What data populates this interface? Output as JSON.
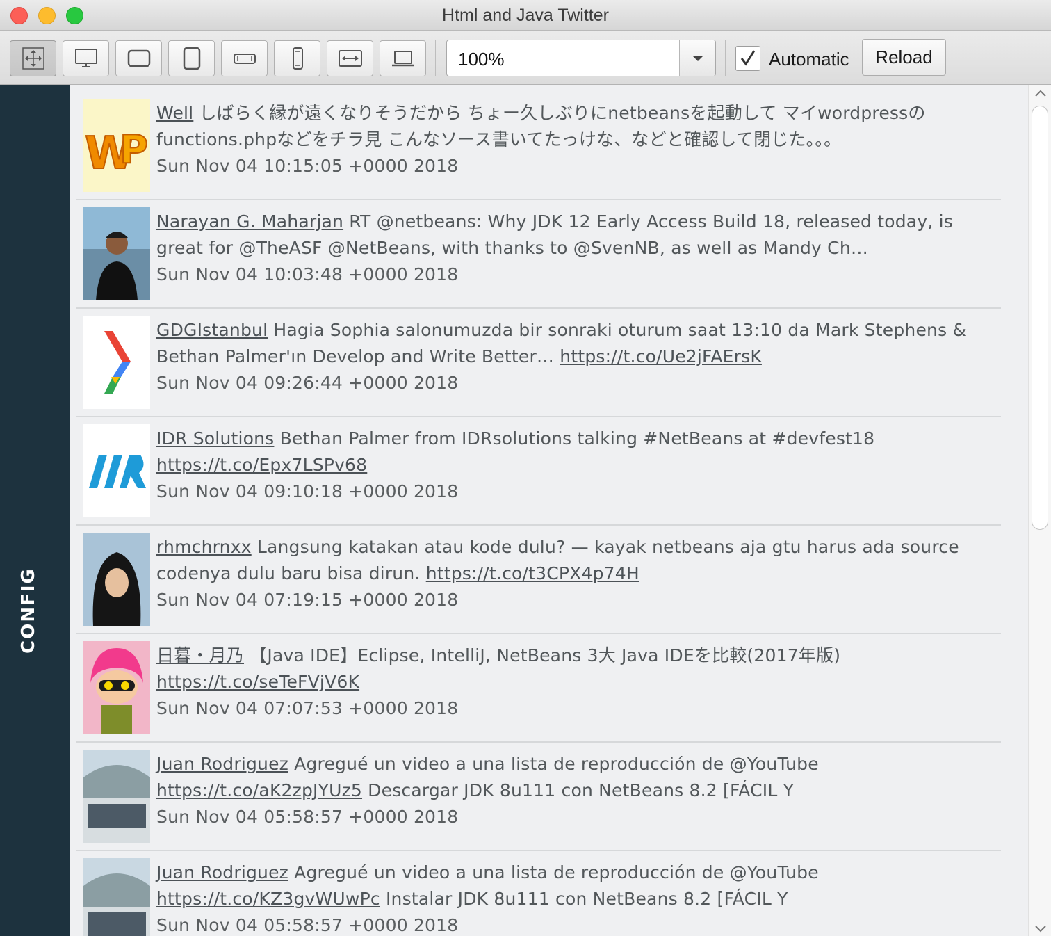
{
  "window": {
    "title": "Html and Java Twitter"
  },
  "toolbar": {
    "device_buttons": [
      {
        "icon": "move-arrows-icon"
      },
      {
        "icon": "desktop-icon"
      },
      {
        "icon": "tablet-landscape-icon"
      },
      {
        "icon": "tablet-portrait-icon"
      },
      {
        "icon": "phone-landscape-icon"
      },
      {
        "icon": "phone-portrait-icon"
      },
      {
        "icon": "fit-width-icon"
      },
      {
        "icon": "laptop-icon"
      }
    ],
    "zoom_value": "100%",
    "automatic_label": "Automatic",
    "automatic_checked": true,
    "reload_label": "Reload"
  },
  "sidebar": {
    "label": "CONFIG"
  },
  "tweets": [
    {
      "user": "Well",
      "text": "しばらく縁が遠くなりそうだから ちょー久しぶりにnetbeansを起動して マイwordpressのfunctions.phpなどをチラ見 こんなソース書いてたっけな、などと確認して閉じた。。。",
      "link": "",
      "text_after": "",
      "date": "Sun Nov 04 10:15:05 +0000 2018"
    },
    {
      "user": "Narayan G. Maharjan",
      "text": "RT @netbeans: Why JDK 12 Early Access Build 18, released today, is great for @TheASF @NetBeans, with thanks to @SvenNB, as well as Mandy Ch…",
      "link": "",
      "text_after": "",
      "date": "Sun Nov 04 10:03:48 +0000 2018"
    },
    {
      "user": "GDGIstanbul",
      "text": "Hagia Sophia salonumuzda bir sonraki oturum saat 13:10 da Mark Stephens & Bethan Palmer'ın Develop and Write Better…",
      "link": "https://t.co/Ue2jFAErsK",
      "text_after": "",
      "date": "Sun Nov 04 09:26:44 +0000 2018"
    },
    {
      "user": "IDR Solutions",
      "text": "Bethan Palmer from IDRsolutions talking #NetBeans at #devfest18",
      "link": "https://t.co/Epx7LSPv68",
      "text_after": "",
      "date": "Sun Nov 04 09:10:18 +0000 2018"
    },
    {
      "user": "rhmchrnxx",
      "text": "Langsung katakan atau kode dulu? — kayak netbeans aja gtu harus ada source codenya dulu baru bisa dirun.",
      "link": "https://t.co/t3CPX4p74H",
      "text_after": "",
      "date": "Sun Nov 04 07:19:15 +0000 2018"
    },
    {
      "user": "日暮・月乃",
      "text": "【Java IDE】Eclipse, IntelliJ, NetBeans 3大 Java IDEを比較(2017年版)",
      "link": "https://t.co/seTeFVjV6K",
      "text_after": "",
      "date": "Sun Nov 04 07:07:53 +0000 2018"
    },
    {
      "user": "Juan Rodriguez",
      "text": "Agregué un video a una lista de reproducción de @YouTube",
      "link": "https://t.co/aK2zpJYUz5",
      "text_after": "Descargar JDK 8u111 con NetBeans 8.2 [FÁCIL Y",
      "date": "Sun Nov 04 05:58:57 +0000 2018"
    },
    {
      "user": "Juan Rodriguez",
      "text": "Agregué un video a una lista de reproducción de @YouTube",
      "link": "https://t.co/KZ3gvWUwPc",
      "text_after": "Instalar JDK 8u111 con NetBeans 8.2 [FÁCIL Y",
      "date": "Sun Nov 04 05:58:57 +0000 2018"
    }
  ],
  "colors": {
    "sidebar": "#1d323e",
    "feed_background": "#eff0f2",
    "text": "#52575a"
  }
}
